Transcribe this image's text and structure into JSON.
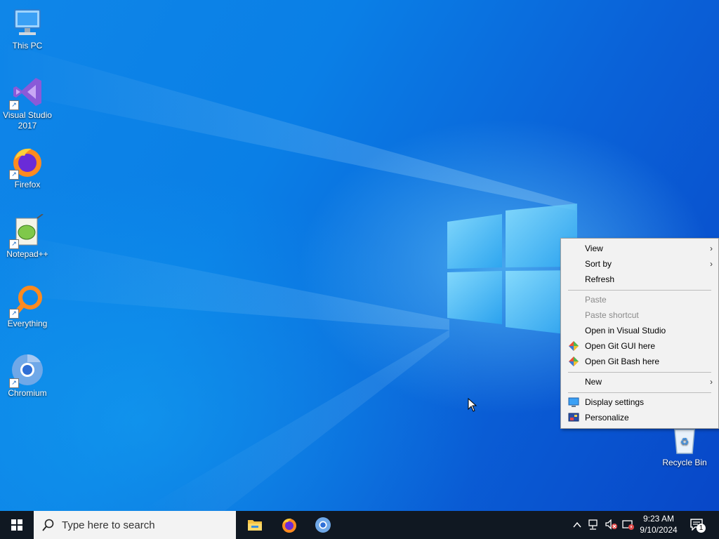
{
  "desktop": {
    "icons": [
      {
        "label": "This PC",
        "icon": "this-pc-icon"
      },
      {
        "label_line1": "Visual Studio",
        "label_line2": "2017",
        "icon": "visual-studio-icon"
      },
      {
        "label": "Firefox",
        "icon": "firefox-icon"
      },
      {
        "label": "Notepad++",
        "icon": "notepad-plus-plus-icon"
      },
      {
        "label": "Everything",
        "icon": "everything-icon"
      },
      {
        "label": "Chromium",
        "icon": "chromium-icon"
      },
      {
        "label": "Recycle Bin",
        "icon": "recycle-bin-icon"
      }
    ]
  },
  "context_menu": {
    "items": [
      {
        "label": "View",
        "submenu": true,
        "enabled": true
      },
      {
        "label": "Sort by",
        "submenu": true,
        "enabled": true
      },
      {
        "label": "Refresh",
        "enabled": true
      },
      {
        "label": "Paste",
        "enabled": false
      },
      {
        "label": "Paste shortcut",
        "enabled": false
      },
      {
        "label": "Open in Visual Studio",
        "enabled": true
      },
      {
        "label": "Open Git GUI here",
        "enabled": true,
        "icon": "git-icon"
      },
      {
        "label": "Open Git Bash here",
        "enabled": true,
        "icon": "git-icon"
      },
      {
        "label": "New",
        "submenu": true,
        "enabled": true
      },
      {
        "label": "Display settings",
        "enabled": true,
        "icon": "display-icon"
      },
      {
        "label": "Personalize",
        "enabled": true,
        "icon": "personalize-icon"
      }
    ],
    "submenu_arrow": "›"
  },
  "taskbar": {
    "search_placeholder": "Type here to search",
    "pinned": [
      {
        "name": "File Explorer",
        "icon": "file-explorer-icon"
      },
      {
        "name": "Firefox",
        "icon": "firefox-icon"
      },
      {
        "name": "Chromium",
        "icon": "chromium-icon"
      }
    ],
    "tray": {
      "time": "9:23 AM",
      "date": "9/10/2024",
      "notification_count": "1"
    }
  },
  "colors": {
    "accent": "#0a78e6",
    "taskbar": "#101822",
    "menu_bg": "#f2f2f2"
  }
}
